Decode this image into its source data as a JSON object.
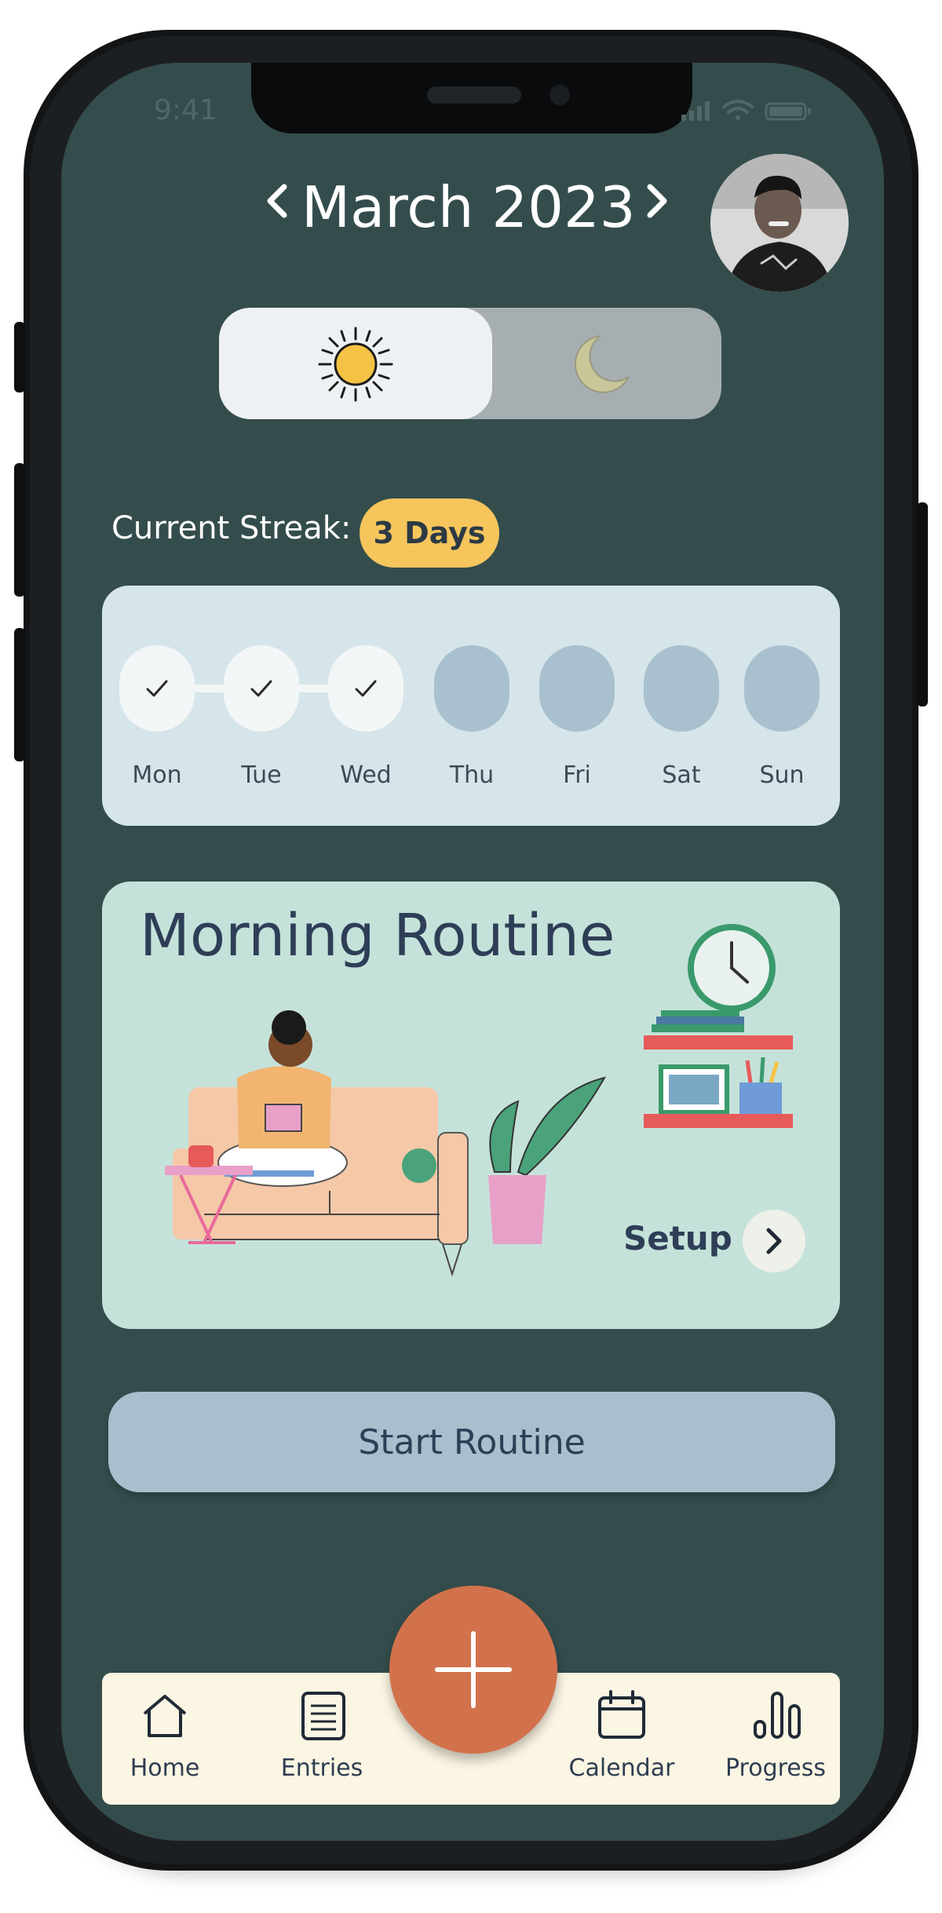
{
  "status_bar": {
    "time": "9:41"
  },
  "header": {
    "prev_icon": "chevron-left-icon",
    "month_title": "March 2023",
    "next_icon": "chevron-right-icon"
  },
  "mode_toggle": {
    "day_icon": "sun-icon",
    "night_icon": "moon-icon"
  },
  "streak": {
    "label": "Current Streak:",
    "value": "3 Days"
  },
  "week": {
    "days": [
      {
        "label": "Mon",
        "done": true
      },
      {
        "label": "Tue",
        "done": true
      },
      {
        "label": "Wed",
        "done": true
      },
      {
        "label": "Thu",
        "done": false
      },
      {
        "label": "Fri",
        "done": false
      },
      {
        "label": "Sat",
        "done": false
      },
      {
        "label": "Sun",
        "done": false
      }
    ]
  },
  "routine": {
    "title": "Morning Routine",
    "setup_label": "Setup"
  },
  "start_button": {
    "label": "Start Routine"
  },
  "tab_bar": {
    "items": [
      {
        "label": "Home",
        "icon": "home-icon"
      },
      {
        "label": "Entries",
        "icon": "document-icon"
      },
      {
        "label": "Calendar",
        "icon": "calendar-icon"
      },
      {
        "label": "Progress",
        "icon": "bar-chart-icon"
      }
    ],
    "fab_icon": "plus-icon"
  },
  "colors": {
    "background": "#344d4c",
    "streak_badge": "#f6c55c",
    "fab": "#d2724c",
    "routine_card": "#c5e2da",
    "week_card": "#d5e5ea"
  }
}
